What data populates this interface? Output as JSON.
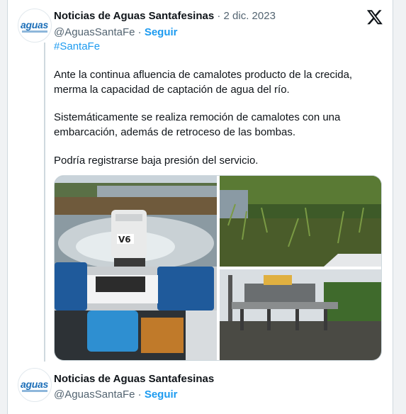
{
  "tweet": {
    "author_name": "Noticias de Aguas Santafesinas",
    "date": "· 2 dic. 2023",
    "handle": "@AguasSantaFe",
    "separator": "·",
    "follow_label": "Seguir",
    "hashtag": "#SantaFe",
    "paragraphs": [
      "Ante la continua afluencia de camalotes producto de la crecida, merma la capacidad de captación de agua del río.",
      "Sistemáticamente se realiza remoción de camalotes con una embarcación, además de retroceso de las bombas.",
      "Podría registrarse baja presión del servicio."
    ],
    "avatar_logo_text": "aguas",
    "boat_label": "V6"
  },
  "reply": {
    "author_name": "Noticias de Aguas Santafesinas",
    "handle": "@AguasSantaFe",
    "separator": "·",
    "follow_label": "Seguir",
    "avatar_logo_text": "aguas"
  },
  "icons": {
    "platform": "x-logo-icon"
  },
  "colors": {
    "link": "#1d9bf0",
    "text": "#0f1419",
    "muted": "#536471"
  }
}
